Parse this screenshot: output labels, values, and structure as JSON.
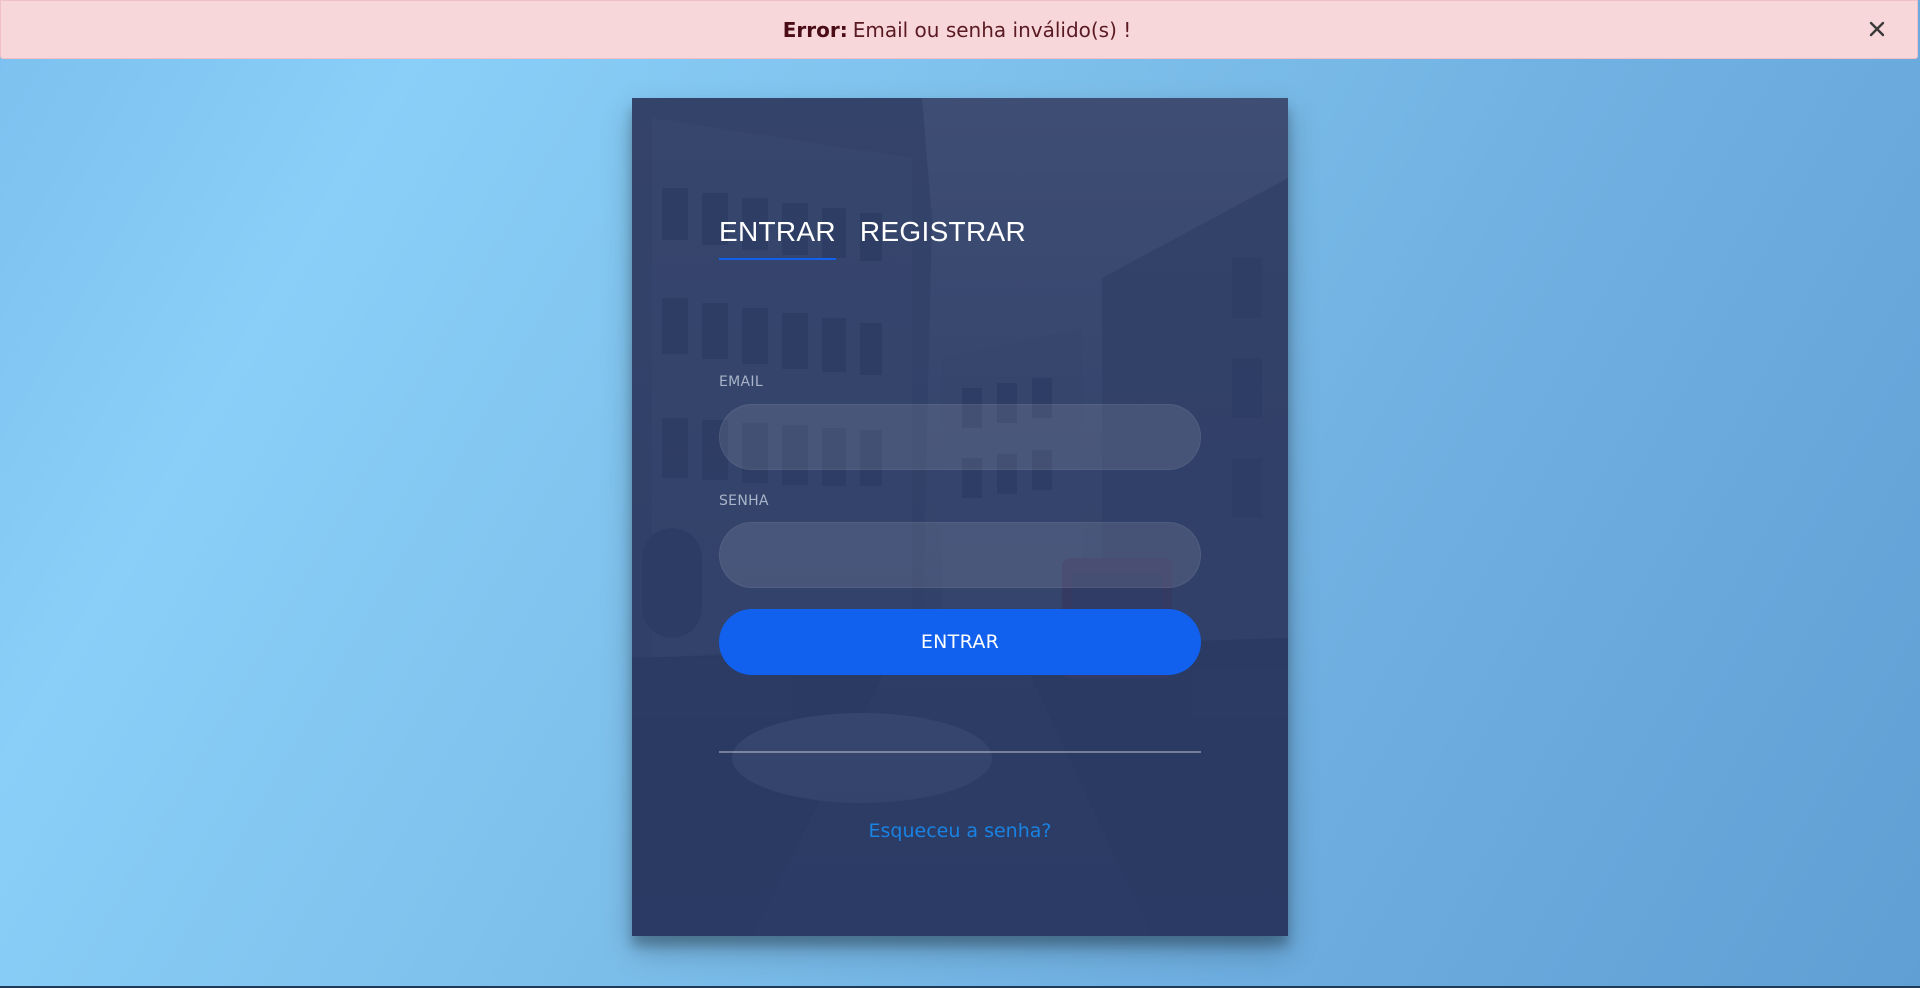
{
  "alert": {
    "prefix": "Error:",
    "message": "Email ou senha inválido(s) !",
    "close_icon": "close-icon",
    "bg_color": "#f8d7da"
  },
  "card": {
    "tabs": [
      {
        "label": "ENTRAR",
        "active": true
      },
      {
        "label": "REGISTRAR",
        "active": false
      }
    ],
    "email": {
      "label": "EMAIL",
      "value": "",
      "placeholder": ""
    },
    "password": {
      "label": "SENHA",
      "value": "",
      "placeholder": ""
    },
    "submit_label": "ENTRAR",
    "forgot_label": "Esqueceu a senha?",
    "accent_color": "#1161ee",
    "link_color": "#1a82e2"
  }
}
